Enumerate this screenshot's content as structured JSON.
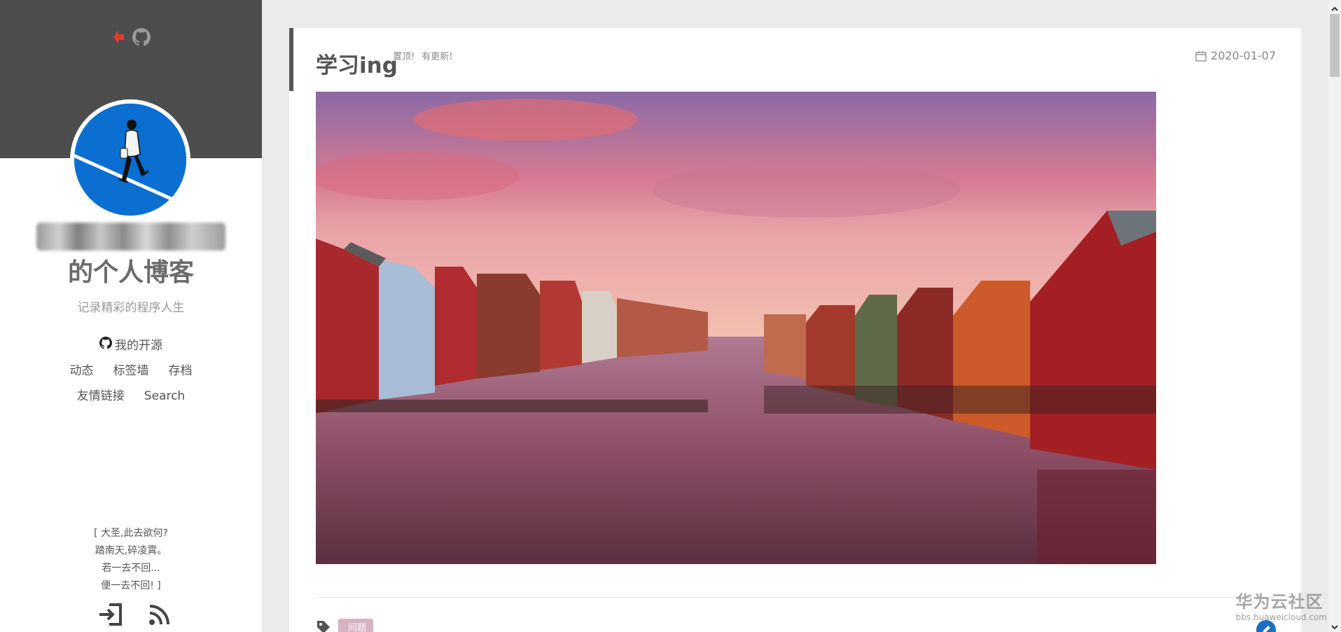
{
  "sidebar": {
    "title_suffix": "的个人博客",
    "subtitle": "记录精彩的程序人生",
    "nav": {
      "open_source": "我的开源",
      "row2": [
        "动态",
        "标签墙",
        "存档"
      ],
      "row3": [
        "友情链接",
        "Search"
      ]
    },
    "quote": [
      "[ 大圣,此去欲何?",
      "踏南天,碎凌霄。",
      "若一去不回...",
      "便一去不回! ]"
    ],
    "icons": {
      "top": [
        "back-arrow-icon",
        "github-icon"
      ],
      "bottom": [
        "sign-in-icon",
        "rss-icon"
      ]
    }
  },
  "post": {
    "title": "学习ing",
    "badge_pinned": "置顶!",
    "badge_updated": "有更新!",
    "date": "2020-01-07",
    "tag": "问题"
  },
  "watermark": {
    "main": "华为云社区",
    "sub": "bbs.huaweicloud.com"
  },
  "colors": {
    "sidebar_header": "#4d4d4d",
    "avatar_bg": "#0a6fd0",
    "tag_pill": "#d6b3c3",
    "page_bg": "#ebebeb"
  }
}
